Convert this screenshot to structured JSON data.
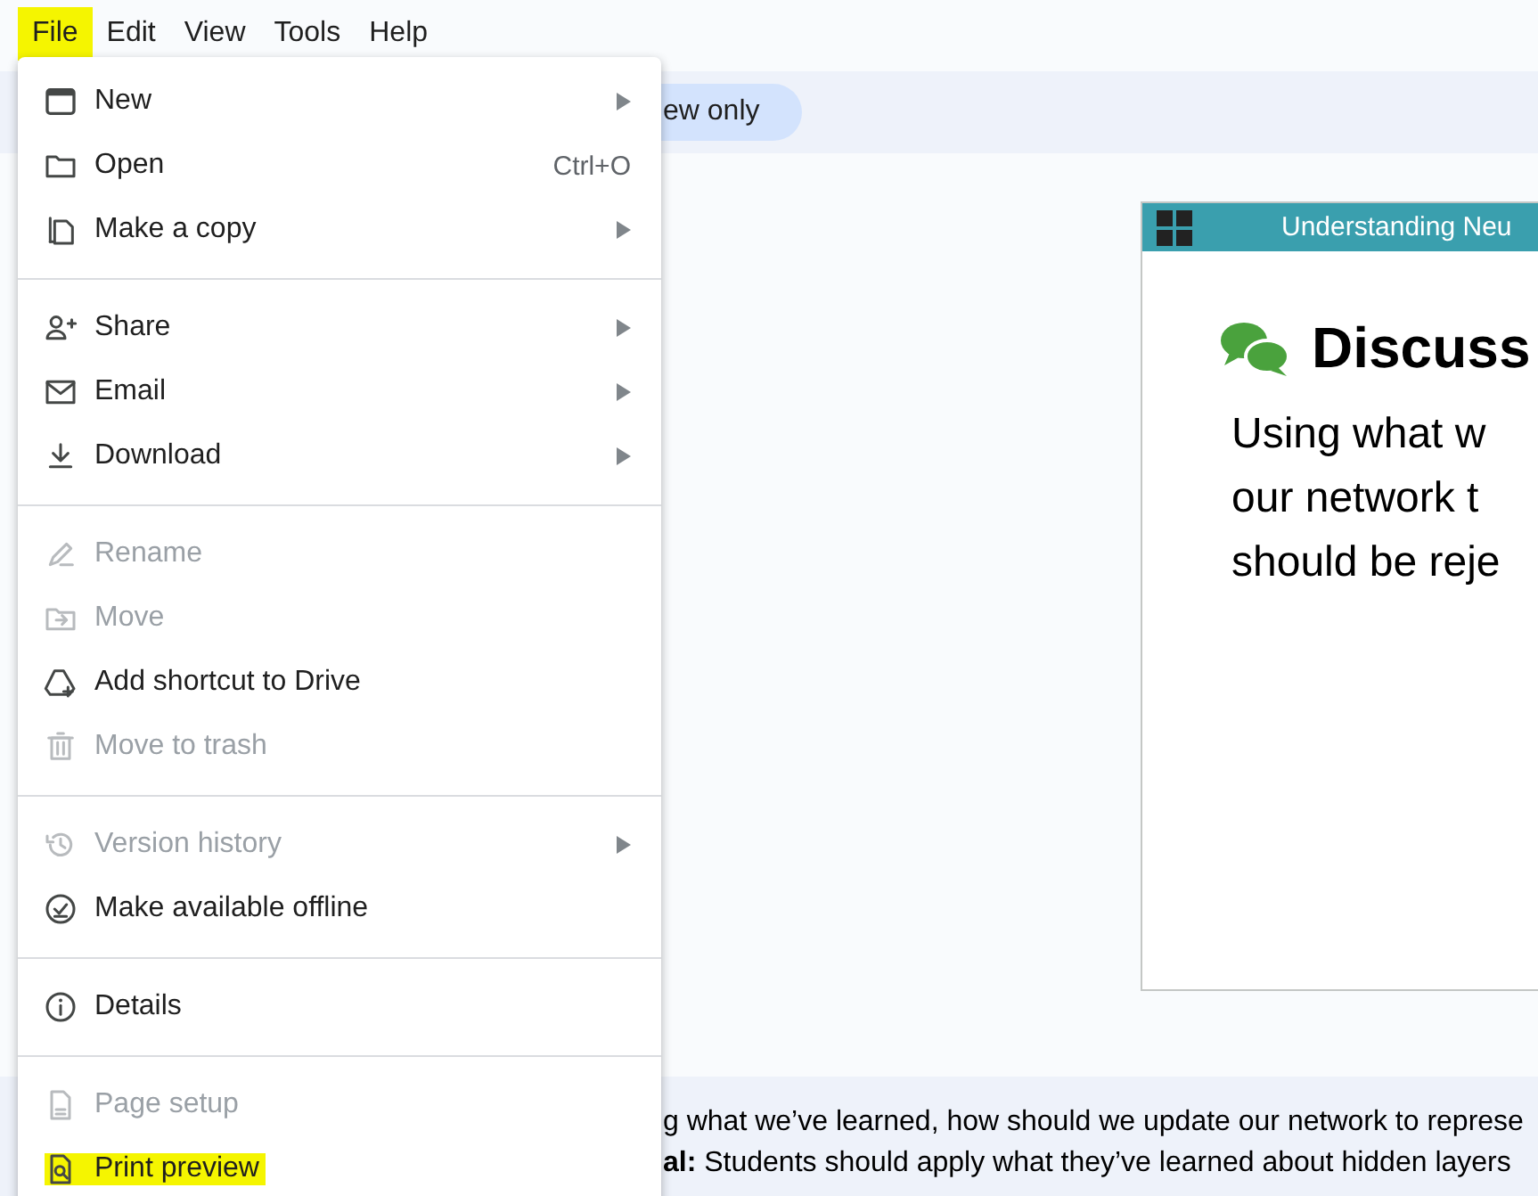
{
  "menubar": [
    {
      "label": "File",
      "highlighted": true
    },
    {
      "label": "Edit",
      "highlighted": false
    },
    {
      "label": "View",
      "highlighted": false
    },
    {
      "label": "Tools",
      "highlighted": false
    },
    {
      "label": "Help",
      "highlighted": false
    }
  ],
  "toolbar": {
    "mode_chip": "ew only"
  },
  "file_menu": [
    {
      "kind": "item",
      "label": "New",
      "submenu": true,
      "disabled": false,
      "highlighted": false
    },
    {
      "kind": "item",
      "label": "Open",
      "shortcut": "Ctrl+O",
      "submenu": false,
      "disabled": false,
      "highlighted": false
    },
    {
      "kind": "item",
      "label": "Make a copy",
      "submenu": true,
      "disabled": false,
      "highlighted": false
    },
    {
      "kind": "separator"
    },
    {
      "kind": "item",
      "label": "Share",
      "submenu": true,
      "disabled": false,
      "highlighted": false
    },
    {
      "kind": "item",
      "label": "Email",
      "submenu": true,
      "disabled": false,
      "highlighted": false
    },
    {
      "kind": "item",
      "label": "Download",
      "submenu": true,
      "disabled": false,
      "highlighted": false
    },
    {
      "kind": "separator"
    },
    {
      "kind": "item",
      "label": "Rename",
      "submenu": false,
      "disabled": true,
      "highlighted": false
    },
    {
      "kind": "item",
      "label": "Move",
      "submenu": false,
      "disabled": true,
      "highlighted": false
    },
    {
      "kind": "item",
      "label": "Add shortcut to Drive",
      "submenu": false,
      "disabled": false,
      "highlighted": false
    },
    {
      "kind": "item",
      "label": "Move to trash",
      "submenu": false,
      "disabled": true,
      "highlighted": false
    },
    {
      "kind": "separator"
    },
    {
      "kind": "item",
      "label": "Version history",
      "submenu": true,
      "disabled": true,
      "highlighted": false
    },
    {
      "kind": "item",
      "label": "Make available offline",
      "submenu": false,
      "disabled": false,
      "highlighted": false
    },
    {
      "kind": "separator"
    },
    {
      "kind": "item",
      "label": "Details",
      "submenu": false,
      "disabled": false,
      "highlighted": false
    },
    {
      "kind": "separator"
    },
    {
      "kind": "item",
      "label": "Page setup",
      "submenu": false,
      "disabled": true,
      "highlighted": false
    },
    {
      "kind": "item",
      "label": "Print preview",
      "submenu": false,
      "disabled": false,
      "highlighted": true
    }
  ],
  "slide": {
    "header": "Understanding Neu",
    "heading": "Discuss",
    "body_lines": [
      "Using what w",
      "our network t",
      "should be reje"
    ]
  },
  "notes": [
    "g what we’ve learned, how should we update our network to represe",
    "**al:** Students should apply what they’ve learned about hidden layers"
  ]
}
